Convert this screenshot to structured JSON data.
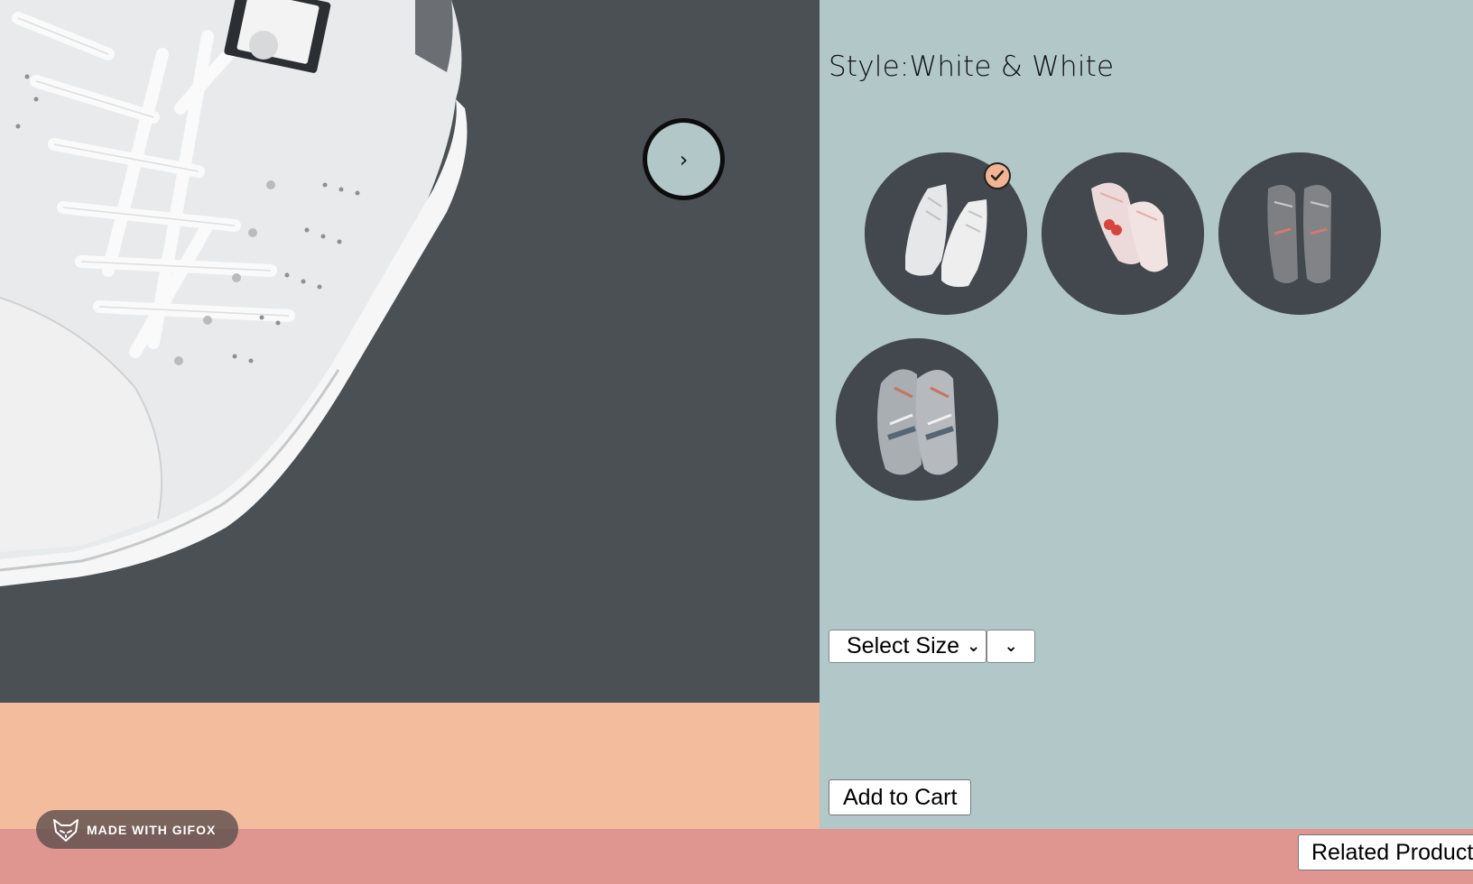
{
  "product": {
    "style_label": "Style:",
    "style_value": "White & White",
    "style_title": "Style:White & White"
  },
  "carousel": {
    "next_label": "›"
  },
  "styles": [
    {
      "name": "White & White",
      "icon": "white-sneakers-image",
      "selected": true
    },
    {
      "name": "White with red heart",
      "icon": "white-heart-sneakers-image",
      "selected": false
    },
    {
      "name": "Grey",
      "icon": "grey-sneakers-image",
      "selected": false
    },
    {
      "name": "Grey & White",
      "icon": "grey-white-sneakers-image",
      "selected": false
    }
  ],
  "size_select": {
    "selected": "Select Size",
    "quantity_selected": ""
  },
  "buttons": {
    "add_to_cart": "Add to Cart",
    "related_products": "Related Products"
  },
  "watermark": {
    "text": "MADE WITH GIFOX",
    "icon": "fox-icon"
  },
  "colors": {
    "panel": "#b2c7c8",
    "peach": "#f2bc9d",
    "bottom_bar": "#df9590",
    "hero_bg": "#4a5054",
    "check": "#f2b594"
  }
}
